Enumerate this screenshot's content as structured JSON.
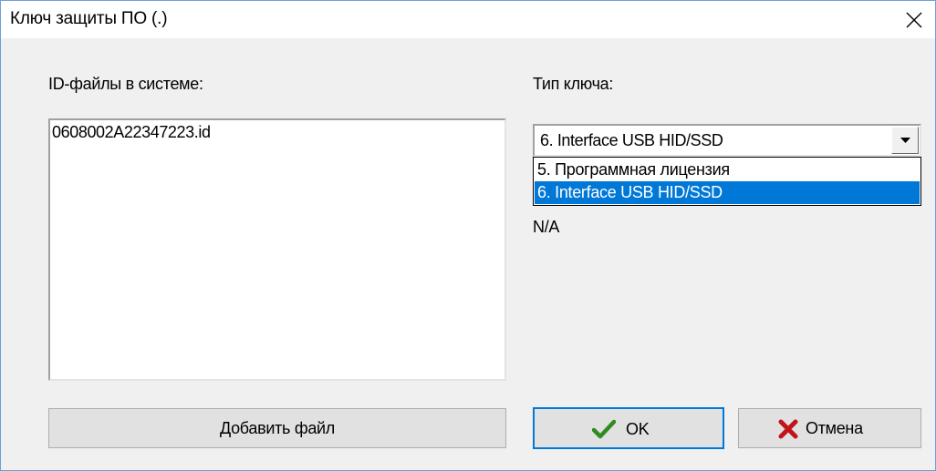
{
  "window": {
    "title": "Ключ защиты ПО (.)",
    "close_icon": "close-icon"
  },
  "left": {
    "label": "ID-файлы в системе:",
    "files": [
      "0608002A22347223.id"
    ],
    "add_button": "Добавить файл"
  },
  "right": {
    "label": "Тип ключа:",
    "combo": {
      "selected": "6. Interface USB HID/SSD",
      "options": [
        "5. Программная лицензия",
        "6. Interface USB HID/SSD"
      ],
      "highlighted_index": 1
    },
    "status": "N/A"
  },
  "buttons": {
    "ok": "OK",
    "cancel": "Отмена",
    "ok_icon": "checkmark-icon",
    "cancel_icon": "cross-icon"
  },
  "colors": {
    "accent": "#0078d7",
    "check": "#2e8b1f",
    "cross": "#c0141b"
  }
}
